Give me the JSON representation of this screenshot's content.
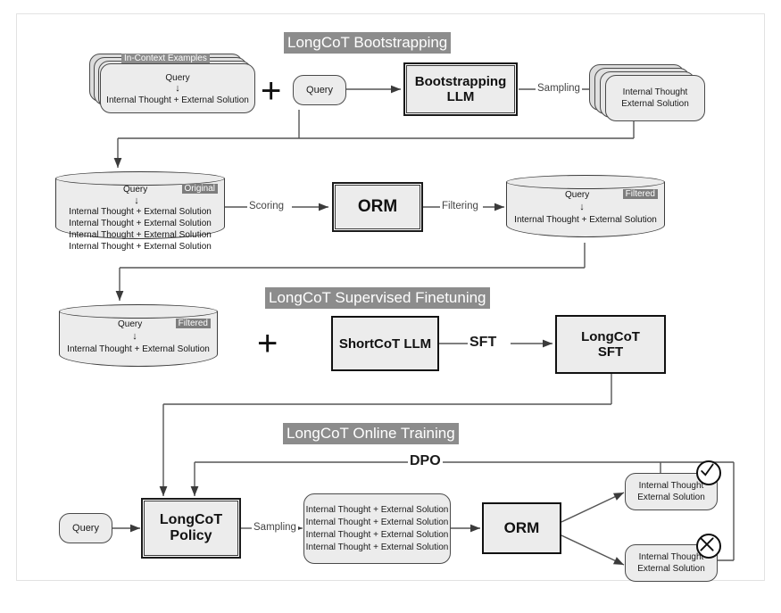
{
  "figure": {
    "sections": [
      {
        "id": "bootstrapping",
        "label": "LongCoT Bootstrapping"
      },
      {
        "id": "sft",
        "label": "LongCoT Supervised Finetuning"
      },
      {
        "id": "online",
        "label": "LongCoT Online Training"
      }
    ],
    "common": {
      "query": "Query",
      "down_arrow": "↓",
      "plus": "+",
      "thought_plus_solution": "Internal Thought + External Solution",
      "internal_thought": "Internal Thought",
      "external_solution": "External Solution"
    },
    "bootstrapping": {
      "incontext_card": {
        "title": "In-Context Examples",
        "query": "Query",
        "body": "Internal Thought + External Solution"
      },
      "query_box": "Query",
      "plus": "+",
      "llm_box": {
        "line1": "Bootstrapping",
        "line2": "LLM"
      },
      "sampling_label": "Sampling",
      "samples_card": {
        "line1": "Internal Thought",
        "line2": "External Solution"
      }
    },
    "scoring_row": {
      "original_db": {
        "query": "Query",
        "tag": "Original",
        "rows": [
          "Internal Thought + External Solution",
          "Internal Thought + External Solution",
          "Internal Thought + External Solution",
          "Internal Thought + External Solution"
        ]
      },
      "scoring_label": "Scoring",
      "orm_box": "ORM",
      "filtering_label": "Filtering",
      "filtered_db": {
        "query": "Query",
        "tag": "Filtered",
        "rows": [
          "Internal Thought + External Solution"
        ]
      }
    },
    "sft_row": {
      "filtered_db": {
        "query": "Query",
        "tag": "Filtered",
        "rows": [
          "Internal Thought + External Solution"
        ]
      },
      "plus": "+",
      "shortcot_box": "ShortCoT LLM",
      "sft_label": "SFT",
      "longcot_sft_box": {
        "line1": "LongCoT",
        "line2": "SFT"
      }
    },
    "online_row": {
      "dpo_label": "DPO",
      "query_box": "Query",
      "policy_box": {
        "line1": "LongCoT",
        "line2": "Policy"
      },
      "sampling_label": "Sampling",
      "samples_card": {
        "rows": [
          "Internal Thought + External Solution",
          "Internal Thought + External Solution",
          "Internal Thought + External Solution",
          "Internal Thought + External Solution"
        ]
      },
      "orm_box": "ORM",
      "chosen_card": {
        "line1": "Internal Thought",
        "line2": "External Solution",
        "mark": "check-mark-icon"
      },
      "rejected_card": {
        "line1": "Internal Thought",
        "line2": "External Solution",
        "mark": "cross-mark-icon"
      }
    }
  }
}
